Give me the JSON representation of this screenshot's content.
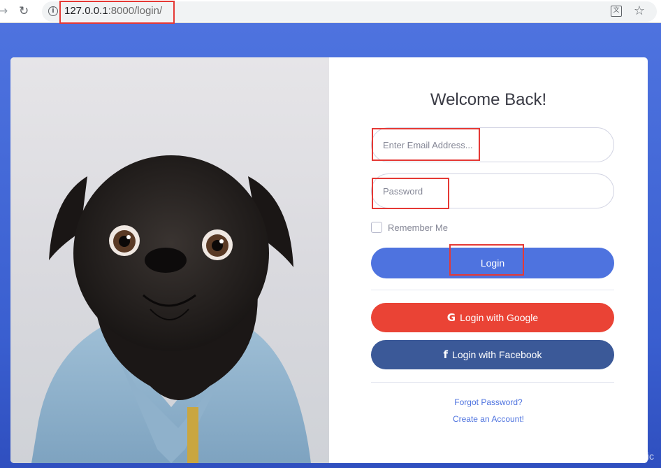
{
  "browser": {
    "back_icon": "→",
    "reload_icon": "↻",
    "info_icon": "i",
    "url_host": "127.0.0.1",
    "url_rest": ":8000/login/",
    "translate_icon": "文",
    "bookmark_icon": "☆"
  },
  "login": {
    "title": "Welcome Back!",
    "email_placeholder": "Enter Email Address...",
    "password_placeholder": "Password",
    "remember_label": "Remember Me",
    "login_button": "Login",
    "google_icon": "G",
    "google_button": "Login with Google",
    "facebook_icon": "f",
    "facebook_button": "Login with Facebook",
    "forgot_link": "Forgot Password?",
    "create_link": "Create an Account!"
  },
  "watermark": "https://blog.csdn.net/g_optimistic",
  "colors": {
    "primary": "#4e73df",
    "google": "#ea4335",
    "facebook": "#3b5998",
    "annotation_red": "#e53935"
  }
}
